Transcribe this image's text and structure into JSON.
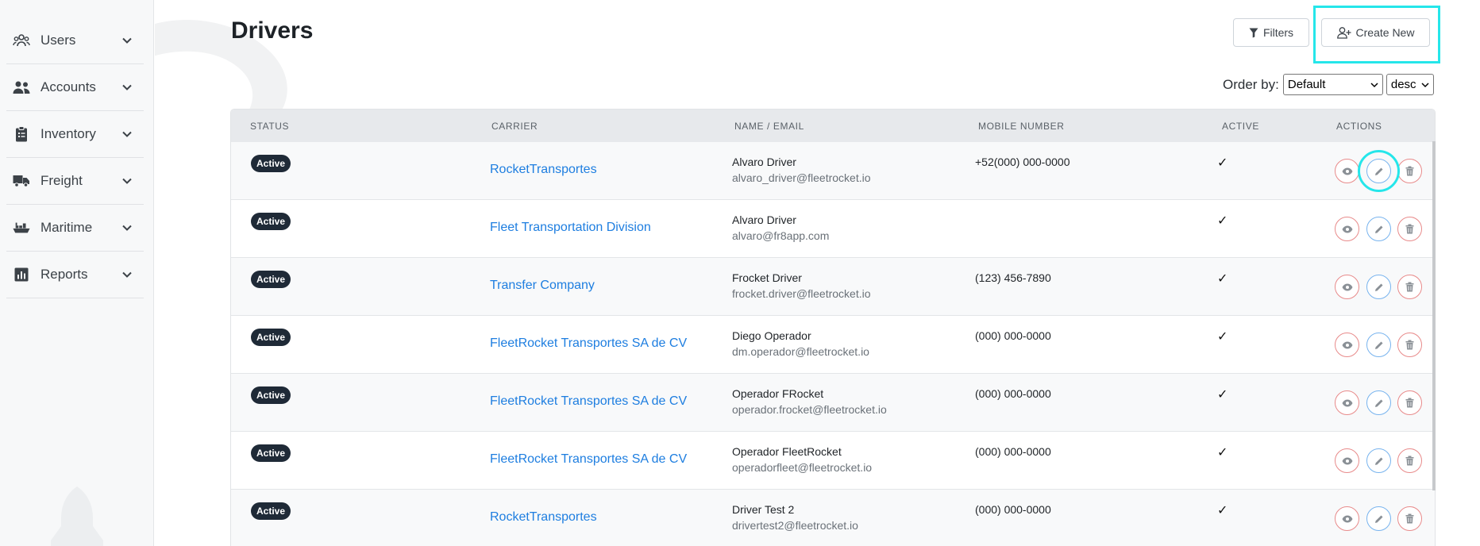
{
  "sidebar": {
    "items": [
      {
        "label": "Users",
        "icon": "users-group-icon"
      },
      {
        "label": "Accounts",
        "icon": "accounts-icon"
      },
      {
        "label": "Inventory",
        "icon": "clipboard-icon"
      },
      {
        "label": "Freight",
        "icon": "truck-icon"
      },
      {
        "label": "Maritime",
        "icon": "ship-icon"
      },
      {
        "label": "Reports",
        "icon": "bar-chart-icon"
      }
    ]
  },
  "header": {
    "title": "Drivers",
    "filters_label": "Filters",
    "create_label": "Create New"
  },
  "order": {
    "label": "Order by:",
    "field": "Default",
    "direction": "desc"
  },
  "table": {
    "columns": [
      "Status",
      "Carrier",
      "Name / Email",
      "Mobile Number",
      "Active",
      "Actions"
    ],
    "rows": [
      {
        "status": "Active",
        "carrier": "RocketTransportes",
        "name": "Alvaro Driver",
        "email": "alvaro_driver@fleetrocket.io",
        "mobile": "+52(000) 000-0000",
        "active": "✓"
      },
      {
        "status": "Active",
        "carrier": "Fleet Transportation Division",
        "name": "Alvaro Driver",
        "email": "alvaro@fr8app.com",
        "mobile": "",
        "active": "✓"
      },
      {
        "status": "Active",
        "carrier": "Transfer Company",
        "name": "Frocket Driver",
        "email": "frocket.driver@fleetrocket.io",
        "mobile": "(123) 456-7890",
        "active": "✓"
      },
      {
        "status": "Active",
        "carrier": "FleetRocket Transportes SA de CV",
        "name": "Diego Operador",
        "email": "dm.operador@fleetrocket.io",
        "mobile": "(000) 000-0000",
        "active": "✓"
      },
      {
        "status": "Active",
        "carrier": "FleetRocket Transportes SA de CV",
        "name": "Operador FRocket",
        "email": "operador.frocket@fleetrocket.io",
        "mobile": "(000) 000-0000",
        "active": "✓"
      },
      {
        "status": "Active",
        "carrier": "FleetRocket Transportes SA de CV",
        "name": "Operador FleetRocket",
        "email": "operadorfleet@fleetrocket.io",
        "mobile": "(000) 000-0000",
        "active": "✓"
      },
      {
        "status": "Active",
        "carrier": "RocketTransportes",
        "name": "Driver Test 2",
        "email": "drivertest2@fleetrocket.io",
        "mobile": "(000) 000-0000",
        "active": "✓"
      }
    ]
  },
  "colors": {
    "link": "#1e7ee0",
    "badge": "#1f2a37",
    "highlight": "#25e6ea",
    "danger_outline": "#e88a8a",
    "edit_outline": "#77b3ee"
  }
}
